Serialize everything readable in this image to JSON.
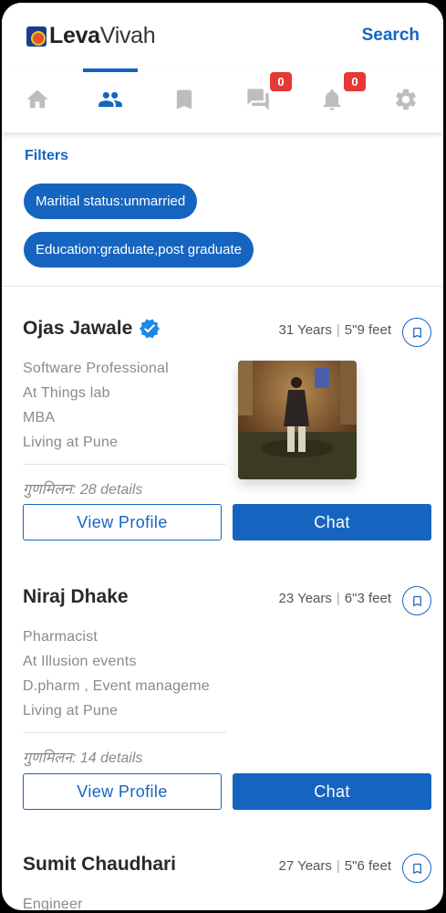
{
  "header": {
    "brand_bold": "Leva",
    "brand_light": "Vivah",
    "search_label": "Search"
  },
  "tabs": [
    {
      "name": "home-icon",
      "active": false
    },
    {
      "name": "people-icon",
      "active": true
    },
    {
      "name": "bookmark-icon",
      "active": false
    },
    {
      "name": "chat-icon",
      "active": false,
      "badge": "0"
    },
    {
      "name": "bell-icon",
      "active": false,
      "badge": "0"
    },
    {
      "name": "gear-icon",
      "active": false
    }
  ],
  "filters": {
    "title": "Filters",
    "chips": [
      "Maritial status:unmarried",
      "Education:graduate,post graduate"
    ]
  },
  "profiles": [
    {
      "name": "Ojas Jawale",
      "verified": true,
      "age": "31 Years",
      "height": "5\"9 feet",
      "details": [
        "Software Professional",
        "At Things lab",
        "MBA",
        "Living at Pune"
      ],
      "gunmilan": "गुणमिलन: 28 details",
      "view_label": "View Profile",
      "chat_label": "Chat"
    },
    {
      "name": "Niraj Dhake",
      "verified": false,
      "age": "23 Years",
      "height": "6\"3 feet",
      "details": [
        "Pharmacist",
        "At Illusion events",
        "D.pharm , Event manageme",
        "Living at Pune"
      ],
      "gunmilan": "गुणमिलन: 14 details",
      "view_label": "View Profile",
      "chat_label": "Chat"
    },
    {
      "name": "Sumit Chaudhari",
      "verified": false,
      "age": "27 Years",
      "height": "5\"6 feet",
      "details": [
        "Engineer"
      ]
    }
  ],
  "colors": {
    "accent": "#1565c0",
    "badge": "#e53935",
    "muted": "#8a8a8a"
  }
}
